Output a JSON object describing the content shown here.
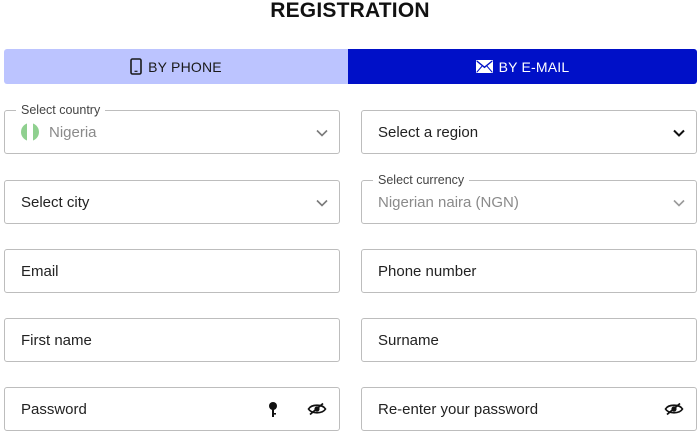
{
  "title": "REGISTRATION",
  "tabs": {
    "phone": {
      "label": "BY PHONE",
      "icon": "smartphone-icon"
    },
    "email": {
      "label": "BY E-MAIL",
      "icon": "envelope-icon",
      "active": true
    }
  },
  "fields": {
    "country": {
      "label": "Select country",
      "value": "Nigeria",
      "icon": "nigeria-flag-icon"
    },
    "region": {
      "placeholder": "Select a region"
    },
    "city": {
      "placeholder": "Select city"
    },
    "currency": {
      "label": "Select currency",
      "value": "Nigerian naira (NGN)"
    },
    "email": {
      "placeholder": "Email"
    },
    "phone": {
      "placeholder": "Phone number"
    },
    "first_name": {
      "placeholder": "First name"
    },
    "surname": {
      "placeholder": "Surname"
    },
    "password": {
      "placeholder": "Password"
    },
    "password_confirm": {
      "placeholder": "Re-enter your password"
    }
  },
  "colors": {
    "tab_inactive_bg": "#bcc4ff",
    "tab_active_bg": "#0010c8",
    "border": "#bdbdbd",
    "flag_green": "#8fd08f"
  }
}
